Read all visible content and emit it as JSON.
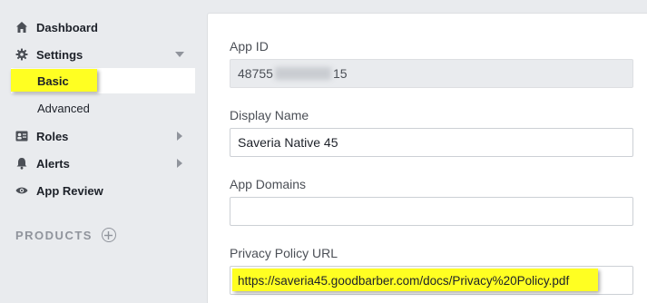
{
  "sidebar": {
    "dashboard": "Dashboard",
    "settings": "Settings",
    "basic": "Basic",
    "advanced": "Advanced",
    "roles": "Roles",
    "alerts": "Alerts",
    "app_review": "App Review",
    "products": "PRODUCTS"
  },
  "form": {
    "app_id_label": "App ID",
    "app_id_prefix": "48755",
    "app_id_suffix": "15",
    "display_name_label": "Display Name",
    "display_name_value": "Saveria Native 45",
    "app_domains_label": "App Domains",
    "app_domains_value": "",
    "privacy_label": "Privacy Policy URL",
    "privacy_value": "https://saveria45.goodbarber.com/docs/Privacy%20Policy.pdf"
  },
  "colors": {
    "highlight": "#ffff22",
    "sidebar_bg": "#e9ebee",
    "card_bg": "#ffffff"
  }
}
